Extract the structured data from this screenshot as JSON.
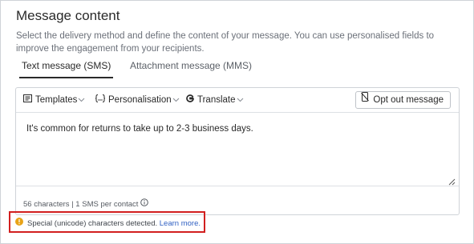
{
  "section": {
    "title": "Message content",
    "description": "Select the delivery method and define the content of your message. You can use personalised fields to improve the engagement from your recipients."
  },
  "tabs": [
    {
      "label": "Text message (SMS)",
      "active": true
    },
    {
      "label": "Attachment message (MMS)",
      "active": false
    }
  ],
  "toolbar": {
    "templates_label": "Templates",
    "personalisation_label": "Personalisation",
    "translate_label": "Translate",
    "opt_out_label": "Opt out message",
    "icons": {
      "templates": "template-list-icon",
      "personalisation": "braces-icon",
      "translate": "google-g-icon",
      "opt_out": "phone-slash-icon",
      "dropdown": "chevron-down-icon"
    }
  },
  "message": {
    "text": "It's common for returns to take up to 2-3 business days."
  },
  "counter": {
    "text": "56 characters | 1 SMS per contact",
    "icon": "info-icon"
  },
  "warning": {
    "text": "Special (unicode) characters detected.",
    "link": "Learn more.",
    "icon": "warning-icon",
    "icon_color": "#e8a317",
    "highlight_color": "#d21f1f"
  }
}
